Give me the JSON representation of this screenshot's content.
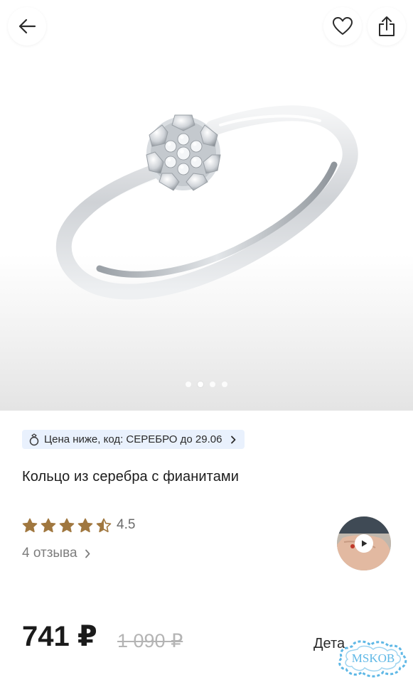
{
  "gallery": {
    "slides_total": 4,
    "active_slide_index": 1,
    "image_alt": "ring"
  },
  "header": {
    "back_icon": "arrow-left-icon",
    "favorite_icon": "heart-outline-icon",
    "share_icon": "share-icon"
  },
  "promo": {
    "icon": "ring-icon",
    "text": "Цена ниже, код: СЕРЕБРО до 29.06",
    "chevron_icon": "chevron-right-icon"
  },
  "product": {
    "title": "Кольцо из серебра с фианитами",
    "rating": {
      "value_text": "4.5",
      "value": 4.5,
      "max": 5,
      "star_color": "#A0773F"
    },
    "reviews_text": "4 отзыва"
  },
  "price": {
    "current": "741 ₽",
    "old": "1 090 ₽"
  },
  "details_link": "Дета",
  "watermark": {
    "text": "MSKOB"
  },
  "colors": {
    "chip_bg": "#E9F1FD",
    "star": "#A0773F",
    "price_old": "#B4B4B4",
    "watermark": "#5FB8E6"
  }
}
